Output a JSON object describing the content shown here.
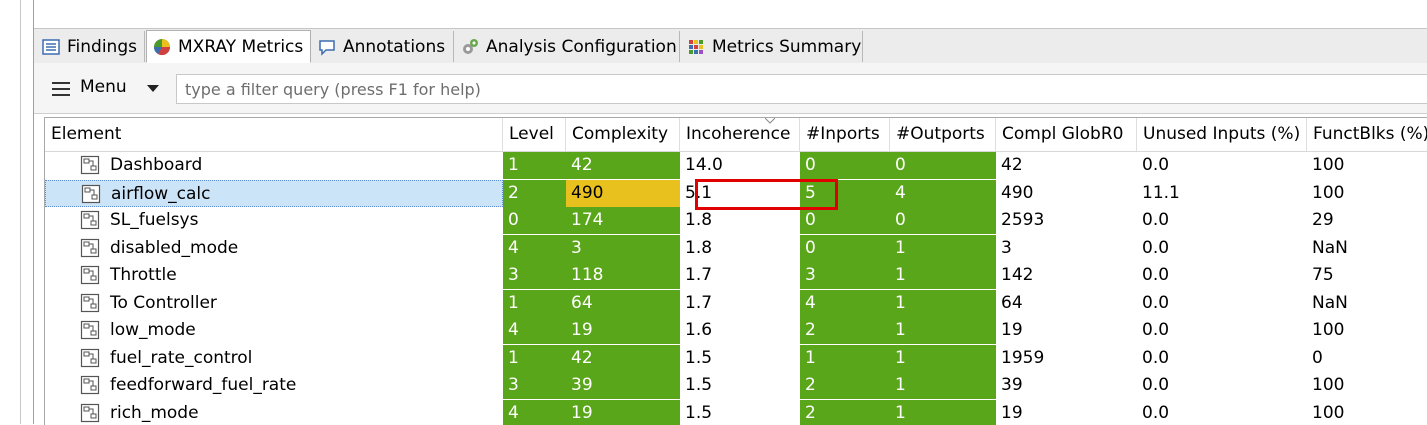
{
  "tabs": [
    {
      "label": "Findings",
      "icon": "list-icon",
      "active": false
    },
    {
      "label": "MXRAY Metrics",
      "icon": "pie-chart-icon",
      "active": true
    },
    {
      "label": "Annotations",
      "icon": "speech-bubble-icon",
      "active": false
    },
    {
      "label": "Analysis Configuration",
      "icon": "gears-icon",
      "active": false
    },
    {
      "label": "Metrics Summary",
      "icon": "grid-icon",
      "active": false
    }
  ],
  "toolbar": {
    "menu_label": "Menu",
    "filter_placeholder": "type a filter query (press F1 for help)",
    "filter_value": ""
  },
  "table": {
    "columns": [
      "Element",
      "Level",
      "Complexity",
      "Incoherence",
      "#Inports",
      "#Outports",
      "Compl GlobR0",
      "Unused Inputs (%)",
      "FunctBlks (%)"
    ],
    "sorted_column": "Incoherence",
    "rows": [
      {
        "element": "Dashboard",
        "level": "1",
        "complexity": "42",
        "incoherence": "14.0",
        "inports": "0",
        "outports": "0",
        "compl_globr0": "42",
        "unused_inputs": "0.0",
        "functblks": "100"
      },
      {
        "element": "airflow_calc",
        "level": "2",
        "complexity": "490",
        "incoherence": "5.1",
        "inports": "5",
        "outports": "4",
        "compl_globr0": "490",
        "unused_inputs": "11.1",
        "functblks": "100",
        "selected": true,
        "complexity_status": "warning"
      },
      {
        "element": "SL_fuelsys",
        "level": "0",
        "complexity": "174",
        "incoherence": "1.8",
        "inports": "0",
        "outports": "0",
        "compl_globr0": "2593",
        "unused_inputs": "0.0",
        "functblks": "29"
      },
      {
        "element": "disabled_mode",
        "level": "4",
        "complexity": "3",
        "incoherence": "1.8",
        "inports": "0",
        "outports": "1",
        "compl_globr0": "3",
        "unused_inputs": "0.0",
        "functblks": "NaN"
      },
      {
        "element": "Throttle",
        "level": "3",
        "complexity": "118",
        "incoherence": "1.7",
        "inports": "3",
        "outports": "1",
        "compl_globr0": "142",
        "unused_inputs": "0.0",
        "functblks": "75"
      },
      {
        "element": "To Controller",
        "level": "1",
        "complexity": "64",
        "incoherence": "1.7",
        "inports": "4",
        "outports": "1",
        "compl_globr0": "64",
        "unused_inputs": "0.0",
        "functblks": "NaN"
      },
      {
        "element": "low_mode",
        "level": "4",
        "complexity": "19",
        "incoherence": "1.6",
        "inports": "2",
        "outports": "1",
        "compl_globr0": "19",
        "unused_inputs": "0.0",
        "functblks": "100"
      },
      {
        "element": "fuel_rate_control",
        "level": "1",
        "complexity": "42",
        "incoherence": "1.5",
        "inports": "1",
        "outports": "1",
        "compl_globr0": "1959",
        "unused_inputs": "0.0",
        "functblks": "0"
      },
      {
        "element": "feedforward_fuel_rate",
        "level": "3",
        "complexity": "39",
        "incoherence": "1.5",
        "inports": "2",
        "outports": "1",
        "compl_globr0": "39",
        "unused_inputs": "0.0",
        "functblks": "100"
      },
      {
        "element": "rich_mode",
        "level": "4",
        "complexity": "19",
        "incoherence": "1.5",
        "inports": "2",
        "outports": "1",
        "compl_globr0": "19",
        "unused_inputs": "0.0",
        "functblks": "100"
      }
    ]
  },
  "colors": {
    "ok": "#5aa61a",
    "warning": "#e9c11f",
    "highlight_box": "#e00000",
    "selection": "#cce4f7"
  }
}
